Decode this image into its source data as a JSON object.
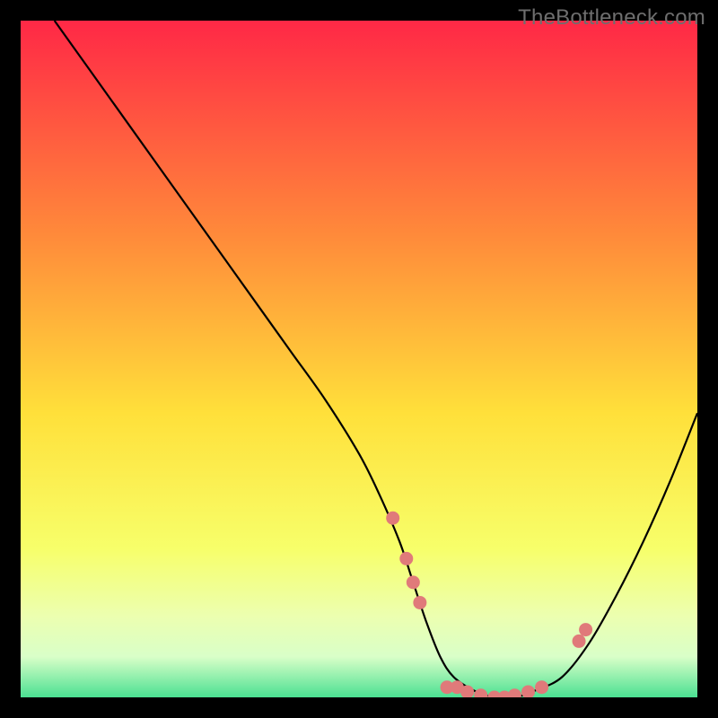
{
  "watermark": "TheBottleneck.com",
  "colors": {
    "frame": "#000000",
    "gradient_top": "#ff2846",
    "gradient_mid_upper": "#ff8b3a",
    "gradient_mid": "#ffe03a",
    "gradient_mid_lower": "#f7ff6a",
    "gradient_low1": "#ecffb0",
    "gradient_low2": "#d9ffc8",
    "gradient_bottom": "#4be092",
    "curve": "#000000",
    "dots": "#e07a7a"
  },
  "chart_data": {
    "type": "line",
    "title": "",
    "xlabel": "",
    "ylabel": "",
    "xlim": [
      0,
      100
    ],
    "ylim": [
      0,
      100
    ],
    "series": [
      {
        "name": "bottleneck-curve",
        "x": [
          5,
          10,
          15,
          20,
          25,
          30,
          35,
          40,
          45,
          50,
          53,
          56,
          58,
          60,
          62,
          64,
          67,
          70,
          73,
          76,
          80,
          84,
          88,
          92,
          96,
          100
        ],
        "y": [
          100,
          93,
          86,
          79,
          72,
          65,
          58,
          51,
          44,
          36,
          30,
          23,
          17,
          11,
          6,
          3,
          1,
          0,
          0,
          1,
          3,
          8,
          15,
          23,
          32,
          42
        ]
      }
    ],
    "markers": [
      {
        "x": 55.0,
        "y": 26.5
      },
      {
        "x": 57.0,
        "y": 20.5
      },
      {
        "x": 58.0,
        "y": 17.0
      },
      {
        "x": 59.0,
        "y": 14.0
      },
      {
        "x": 63.0,
        "y": 1.5
      },
      {
        "x": 64.5,
        "y": 1.5
      },
      {
        "x": 66.0,
        "y": 0.8
      },
      {
        "x": 68.0,
        "y": 0.3
      },
      {
        "x": 70.0,
        "y": 0.0
      },
      {
        "x": 71.5,
        "y": 0.0
      },
      {
        "x": 73.0,
        "y": 0.3
      },
      {
        "x": 75.0,
        "y": 0.8
      },
      {
        "x": 77.0,
        "y": 1.5
      },
      {
        "x": 82.5,
        "y": 8.3
      },
      {
        "x": 83.5,
        "y": 10.0
      }
    ]
  }
}
